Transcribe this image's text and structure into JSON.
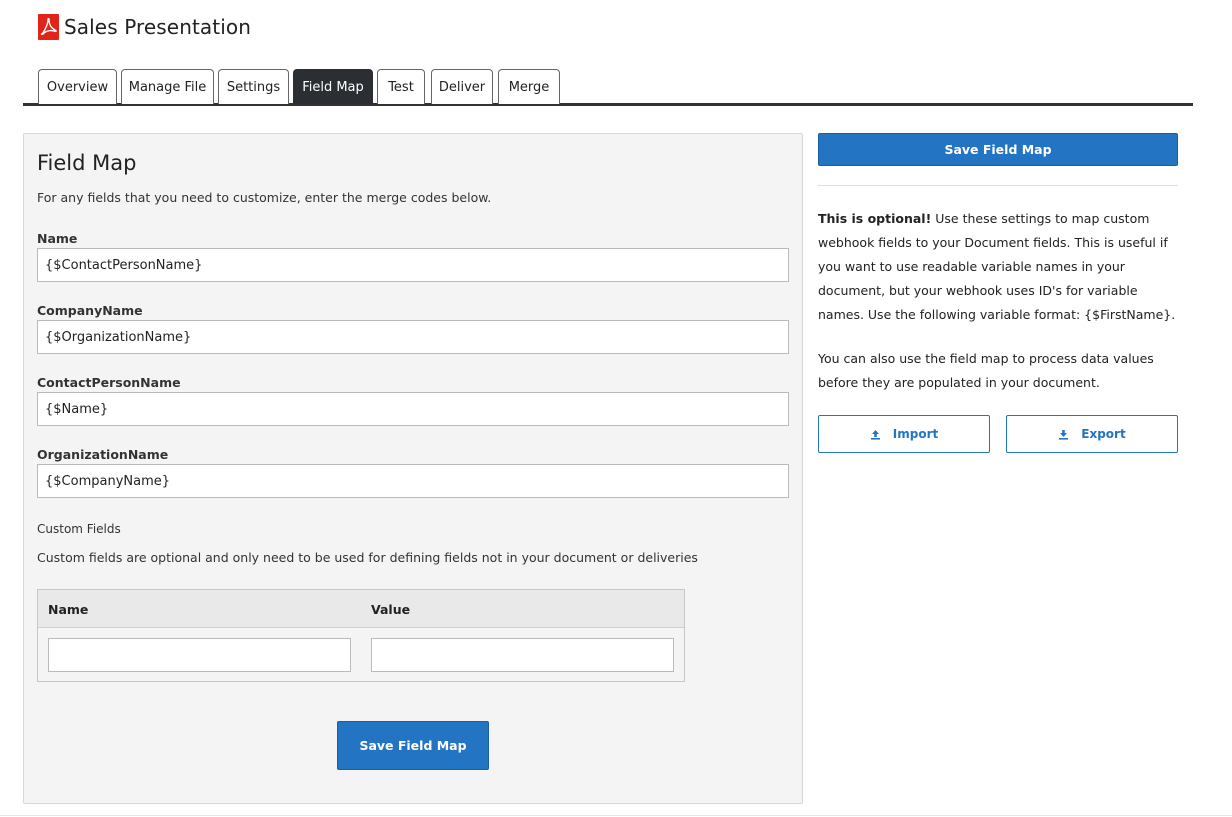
{
  "app": {
    "title": "Sales Presentation",
    "icon": "pdf-icon"
  },
  "tabs": [
    {
      "label": "Overview"
    },
    {
      "label": "Manage File"
    },
    {
      "label": "Settings"
    },
    {
      "label": "Field Map",
      "active": true
    },
    {
      "label": "Test"
    },
    {
      "label": "Deliver"
    },
    {
      "label": "Merge"
    }
  ],
  "panel": {
    "title": "Field Map",
    "intro": "For any fields that you need to customize, enter the merge codes below.",
    "fields": [
      {
        "label": "Name",
        "value": "{$ContactPersonName}"
      },
      {
        "label": "CompanyName",
        "value": "{$OrganizationName}"
      },
      {
        "label": "ContactPersonName",
        "value": "{$Name}"
      },
      {
        "label": "OrganizationName",
        "value": "{$CompanyName}"
      }
    ],
    "custom_fields": {
      "label": "Custom Fields",
      "description": "Custom fields are optional and only need to be used for defining fields not in your document or deliveries",
      "columns": [
        "Name",
        "Value"
      ],
      "row": {
        "name": "",
        "value": ""
      }
    },
    "save_label": "Save Field Map"
  },
  "sidebar": {
    "save_label": "Save Field Map",
    "help_bold": "This is optional!",
    "help_text": " Use these settings to map custom webhook fields to your Document fields. This is useful if you want to use readable variable names in your document, but your webhook uses ID's for variable names. Use the following variable format: {$FirstName}.",
    "help_text2": "You can also use the field map to process data values before they are populated in your document.",
    "import_label": "Import",
    "export_label": "Export"
  },
  "colors": {
    "accent": "#2474c4",
    "active_tab": "#2b2e33",
    "pdf_red": "#e2231a"
  }
}
